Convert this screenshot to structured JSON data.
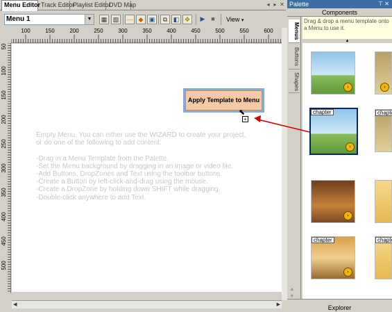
{
  "tabs": [
    "Menu Editor",
    "Track Editor",
    "Playlist Editor",
    "DVD Map"
  ],
  "toolbar": {
    "menu_select": "Menu 1",
    "view_label": "View"
  },
  "ruler_top": [
    "100",
    "150",
    "200",
    "250",
    "300",
    "350",
    "400",
    "450",
    "500",
    "550",
    "600"
  ],
  "ruler_left": [
    "50",
    "100",
    "150",
    "200",
    "250",
    "300",
    "350",
    "400",
    "450",
    "500"
  ],
  "canvas": {
    "empty_message": "Empty Menu. You can either use the WIZARD to create your project,\nor do one of the following to add content:\n\n-Drag in a Menu Template from the Palette.\n-Set the Menu background by dragging in an image or video file.\n-Add Buttons, DropZones and Text using the toolbar buttons.\n-Create a Button by left-click-and-drag using the mouse.\n-Create a DropZone by holding down SHIFT while dragging.\n-Double-click anywhere to add Text.",
    "apply_template_label": "Apply Template to Menu"
  },
  "palette": {
    "title": "Palette",
    "components_label": "Components",
    "hint": "Drag & drop a menu template onto a Menu to use it.",
    "vtabs": [
      "Menus",
      "Buttons",
      "Shapes"
    ],
    "thumb_captions": [
      "chapter",
      "chapter",
      "chapter",
      "chapter"
    ],
    "explorer_label": "Explorer"
  },
  "colors": {
    "accent": "#3a6ea5",
    "apply_button": "#f7c9a4",
    "apply_border": "#8aa8d6",
    "arrow": "#d00000",
    "selection": "#0a246a"
  }
}
